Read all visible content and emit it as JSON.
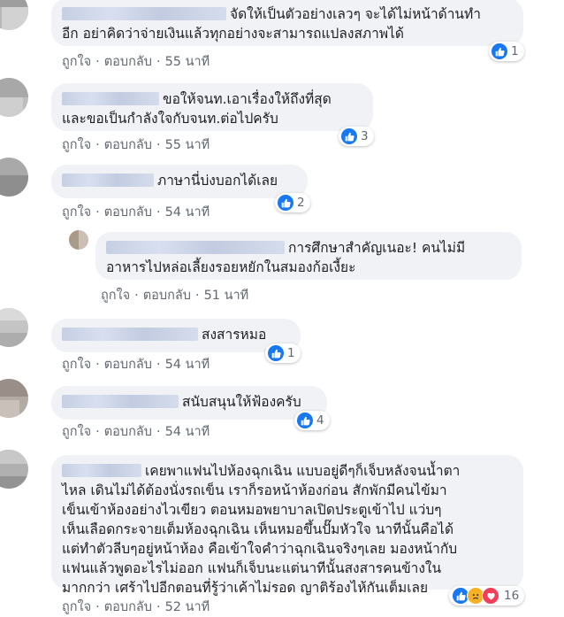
{
  "actions": {
    "like": "ถูกใจ",
    "reply": "ตอบกลับ",
    "separator": "·"
  },
  "comments": [
    {
      "line1": "จัดให้เป็นตัวอย่างเลวๆ จะได้ไม่หน้าด้านทำ",
      "line2": "อีก อย่าคิดว่าจ่ายเงินแล้วทุกอย่างจะสามารถแปลงสภาพได้",
      "time": "55 นาที",
      "reactions": "1",
      "reaction_icon": "like-icon"
    },
    {
      "line1": "ขอให้จนท.เอาเรื่องให้ถึงที่สุด",
      "line2": "และขอเป็นกำลังใจกับจนท.ต่อไปครับ",
      "time": "55 นาที",
      "reactions": "3",
      "reaction_icon": "like-icon"
    },
    {
      "line1": "ภาษานี่บ่งบอกได้เลย",
      "time": "54 นาที",
      "reactions": "2",
      "reaction_icon": "like-icon"
    },
    {
      "line1": "การศึกษาสำคัญเนอะ! คนไม่มี",
      "line2": "อาหารไปหล่อเลี้ยงรอยหยักในสมองก้อเงี้ยะ",
      "time": "51 นาที"
    },
    {
      "line1": "สงสารหมอ",
      "time": "54 นาที",
      "reactions": "1",
      "reaction_icon": "like-icon"
    },
    {
      "line1": "สนับสนุนให้ฟ้องครับ",
      "time": "54 นาที",
      "reactions": "4",
      "reaction_icon": "like-icon"
    },
    {
      "lines": [
        "เคยพาแฟนไปห้องฉุกเฉิน แบบอยู่ดีๆก็เจ็บหลังจนน้ำตา",
        "ไหล เดินไม่ได้ต้องนั่งรถเข็น เราก็รอหน้าห้องก่อน สักพักมีคนไข้มา",
        "เข็นเข้าห้องอย่างไวเขียว ตอนหมอพยาบาลเปิดประตูเข้าไป แว่บๆ",
        "เห็นเลือดกระจายเต็มห้องฉุกเฉิน เห็นหมอขึ้นปั๊มหัวใจ นาทีนั้นคือได้",
        "แต่ทำตัวลีบๆอยู่หน้าห้อง คือเข้าใจคำว่าฉุกเฉินจริงๆเลย มองหน้ากับ",
        "แฟนแล้วพูดอะไรไม่ออก แฟนก็เจ็บนะแต่นาทีนั้นสงสารคนข้างใน",
        "มากกว่า เศร้าไปอีกตอนที่รู้ว่าเค้าไม่รอด ญาติร้องไห้กันเต็มเลย"
      ],
      "time": "52 นาที",
      "reactions": "16",
      "reaction_icons": [
        "like-icon",
        "sad-icon",
        "love-icon"
      ]
    }
  ],
  "colors": {
    "like_blue": "#1877f2",
    "bubble_bg": "#f0f2f5",
    "meta_gray": "#606770",
    "love_red": "#f33e58",
    "sad_yellow": "#f7b125"
  }
}
